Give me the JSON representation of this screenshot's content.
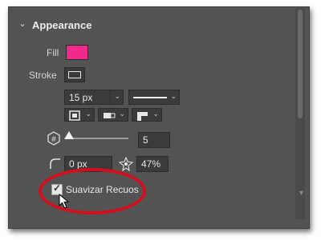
{
  "section": {
    "title": "Appearance"
  },
  "fill": {
    "label": "Fill",
    "color": "#f02a8a"
  },
  "stroke": {
    "label": "Stroke",
    "width_value": "15 px",
    "style_value": "solid"
  },
  "corners": {
    "value": "5"
  },
  "radius": {
    "value": "0 px"
  },
  "opacity": {
    "value": "47%"
  },
  "smoothing": {
    "label": "Suavizar Recuos",
    "checked": true
  },
  "colors": {
    "panel": "#535353",
    "field": "#3b3b3b",
    "highlight_ring": "#d40f1d"
  }
}
